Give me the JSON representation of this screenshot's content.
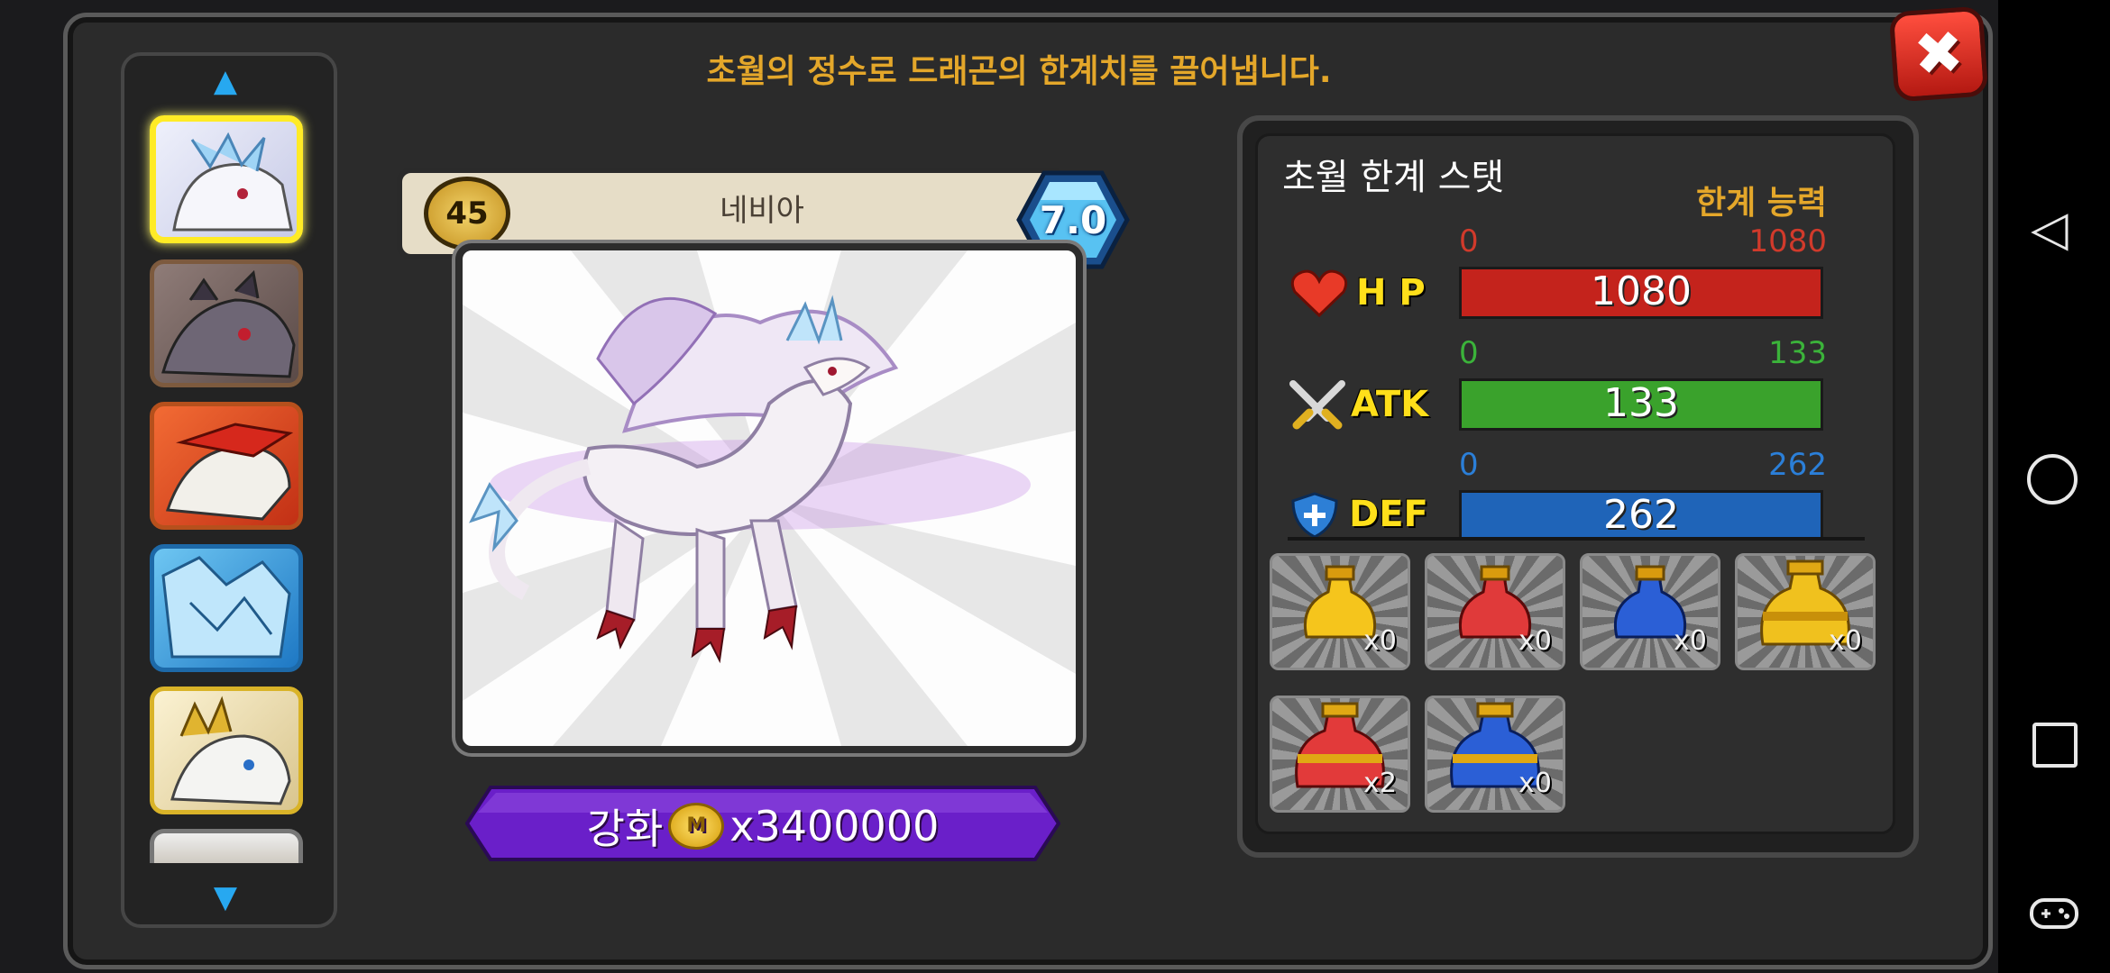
{
  "header": {
    "title": "초월의 정수로 드래곤의 한계치를 끌어냅니다.",
    "close_label": "✖"
  },
  "sidebar": {
    "up_arrow": "▲",
    "down_arrow": "▼",
    "items": [
      {
        "icon": "dragon-thumb-selected",
        "color": "#d9dcef"
      },
      {
        "icon": "dragon-thumb-grey",
        "color": "#7b6d6d"
      },
      {
        "icon": "dragon-thumb-red",
        "color": "#e2572a"
      },
      {
        "icon": "dragon-thumb-ice",
        "color": "#3fa3d9"
      },
      {
        "icon": "dragon-thumb-gold",
        "color": "#e9d9a6"
      },
      {
        "icon": "dragon-thumb-partial",
        "color": "#d8d2c8"
      }
    ]
  },
  "dragon": {
    "level": "45",
    "name": "네비아",
    "grade": "7.0"
  },
  "upgrade": {
    "label": "강화",
    "coin_text": "M",
    "cost": "x3400000"
  },
  "stats": {
    "title": "초월 한계 스탯",
    "subtitle": "한계 능력",
    "hp": {
      "label": "H P",
      "min": "0",
      "max": "1080",
      "value": "1080",
      "color": "#c4231c",
      "range_color": "#d13a2b",
      "fill": 1.0
    },
    "atk": {
      "label": "ATK",
      "min": "0",
      "max": "133",
      "value": "133",
      "color": "#3aa22c",
      "range_color": "#3bb33a",
      "fill": 1.0
    },
    "def": {
      "label": "DEF",
      "min": "0",
      "max": "262",
      "value": "262",
      "color": "#1f64b8",
      "range_color": "#2b7fd8",
      "fill": 1.0
    }
  },
  "items": [
    {
      "name": "yellow-potion",
      "count": "x0",
      "color": "#f5c51c"
    },
    {
      "name": "red-potion",
      "count": "x0",
      "color": "#e03a3a"
    },
    {
      "name": "blue-potion",
      "count": "x0",
      "color": "#2b5fd6"
    },
    {
      "name": "gold-large-potion",
      "count": "x0",
      "color": "#f0c11e"
    },
    {
      "name": "red-large-potion",
      "count": "x2",
      "color": "#e23a3a"
    },
    {
      "name": "blue-large-potion",
      "count": "x0",
      "color": "#2b5fd6"
    }
  ],
  "system_nav": {
    "back": "◁",
    "home": "○",
    "recent": "□",
    "game": "gamepad-icon"
  }
}
